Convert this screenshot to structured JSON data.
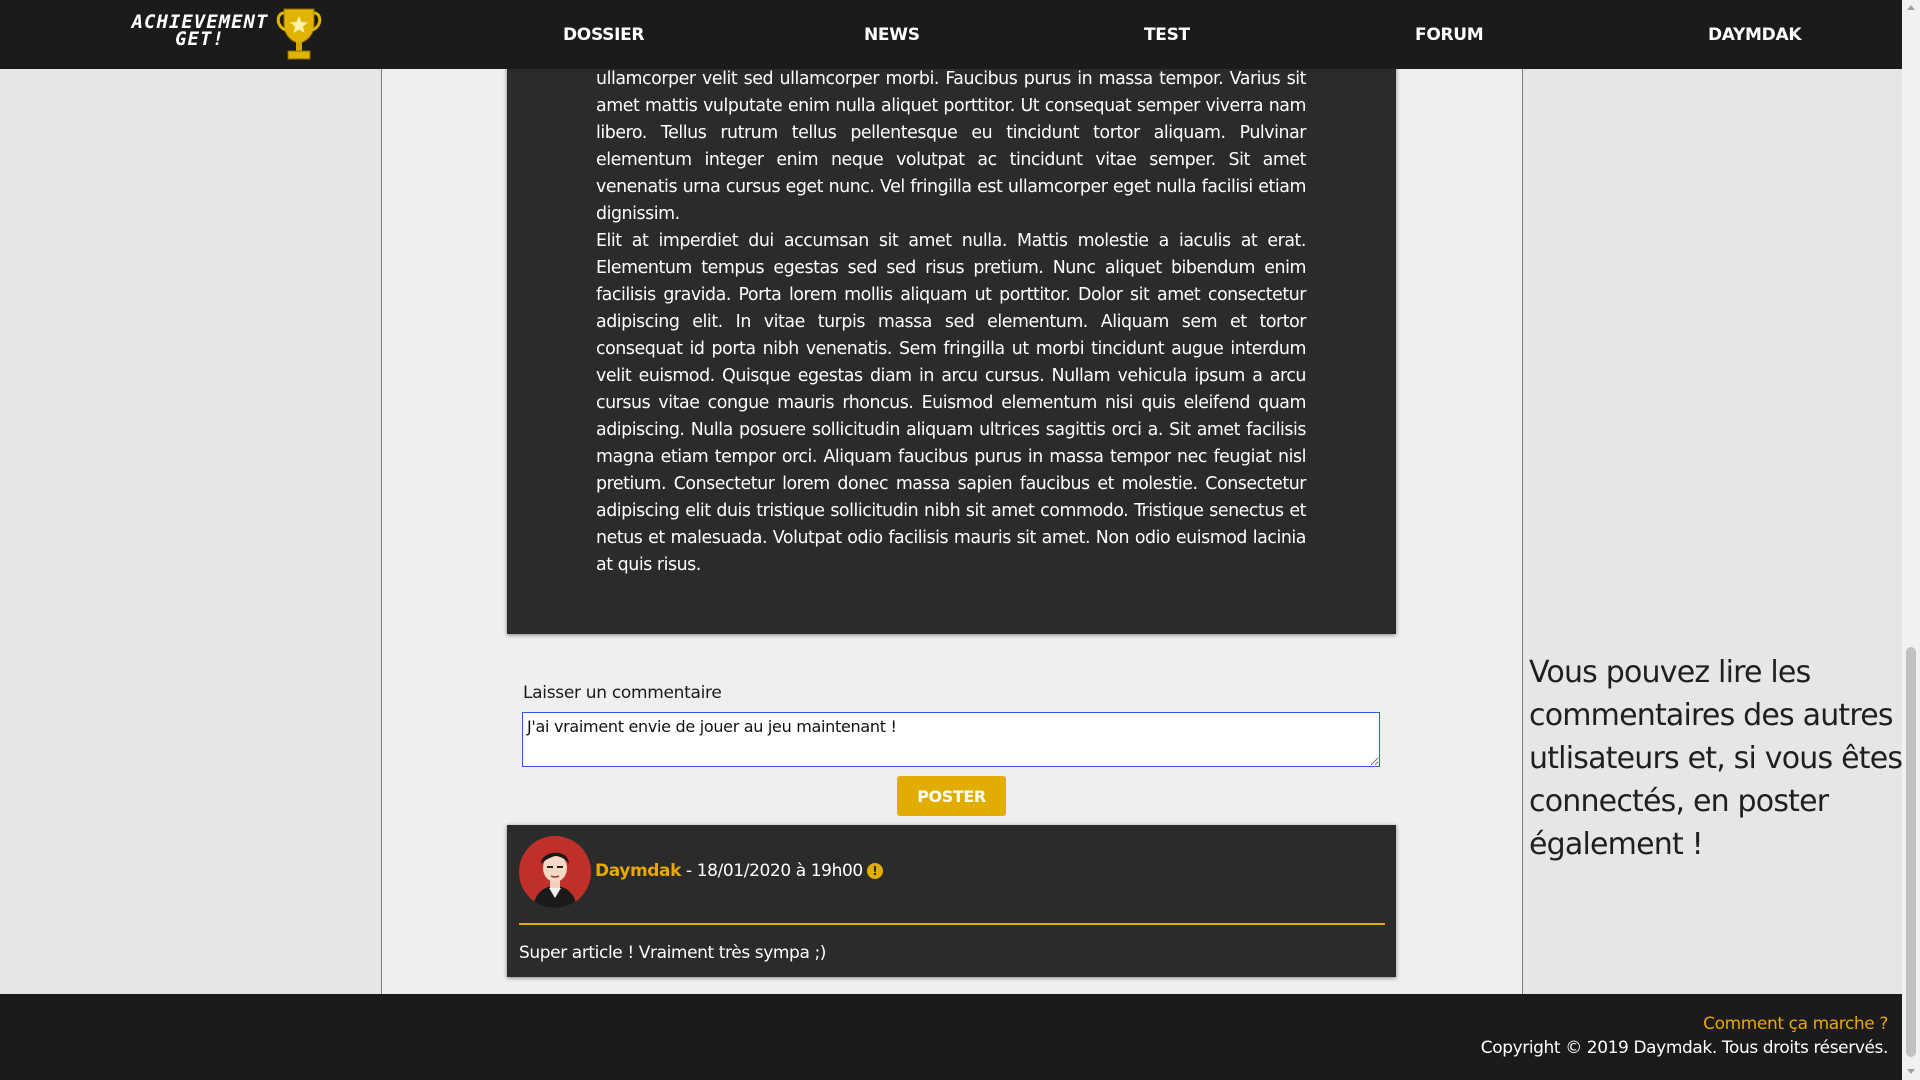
{
  "header": {
    "logo_text_line1": "ACHIEVEMENT",
    "logo_text_line2": "GET!",
    "nav": [
      {
        "label": "DOSSIER"
      },
      {
        "label": "NEWS"
      },
      {
        "label": "TEST"
      },
      {
        "label": "FORUM"
      },
      {
        "label": "DAYMDAK"
      }
    ]
  },
  "article": {
    "paragraphs": [
      "ullamcorper velit sed ullamcorper morbi. Faucibus purus in massa tempor. Varius sit amet mattis vulputate enim nulla aliquet porttitor. Ut consequat semper viverra nam libero. Tellus rutrum tellus pellentesque eu tincidunt tortor aliquam. Pulvinar elementum integer enim neque volutpat ac tincidunt vitae semper. Sit amet venenatis urna cursus eget nunc. Vel fringilla est ullamcorper eget nulla facilisi etiam dignissim.",
      "Elit at imperdiet dui accumsan sit amet nulla. Mattis molestie a iaculis at erat. Elementum tempus egestas sed sed risus pretium. Nunc aliquet bibendum enim facilisis gravida. Porta lorem mollis aliquam ut porttitor. Dolor sit amet consectetur adipiscing elit. In vitae turpis massa sed elementum. Aliquam sem et tortor consequat id porta nibh venenatis. Sem fringilla ut morbi tincidunt augue interdum velit euismod. Quisque egestas diam in arcu cursus. Nullam vehicula ipsum a arcu cursus vitae congue mauris rhoncus. Euismod elementum nisi quis eleifend quam adipiscing. Nulla posuere sollicitudin aliquam ultrices sagittis orci a. Sit amet facilisis magna etiam tempor orci. Aliquam faucibus purus in massa tempor nec feugiat nisl pretium. Consectetur lorem donec massa sapien faucibus et molestie. Consectetur adipiscing elit duis tristique sollicitudin nibh sit amet commodo. Tristique senectus et netus et malesuada. Volutpat odio facilisis mauris sit amet. Non odio euismod lacinia at quis risus."
    ]
  },
  "comment_form": {
    "label": "Laisser un commentaire",
    "value": "J'ai vraiment envie de jouer au jeu maintenant !",
    "submit_label": "POSTER"
  },
  "comments": [
    {
      "author": "Daymdak",
      "date": " - 18/01/2020 à 19h00",
      "icon": "warning-icon",
      "body": "Super article ! Vraiment très sympa ;)"
    }
  ],
  "sidebar": {
    "note": "Vous pouvez lire les commentaires des autres utlisateurs et, si vous êtes connectés, en poster également !"
  },
  "footer": {
    "link": "Comment ça marche ?",
    "copyright": "Copyright © 2019 Daymdak. Tous droits réservés."
  },
  "colors": {
    "accent": "#e0ad00",
    "dark": "#1b1b1b",
    "card": "#2b2b2b"
  }
}
